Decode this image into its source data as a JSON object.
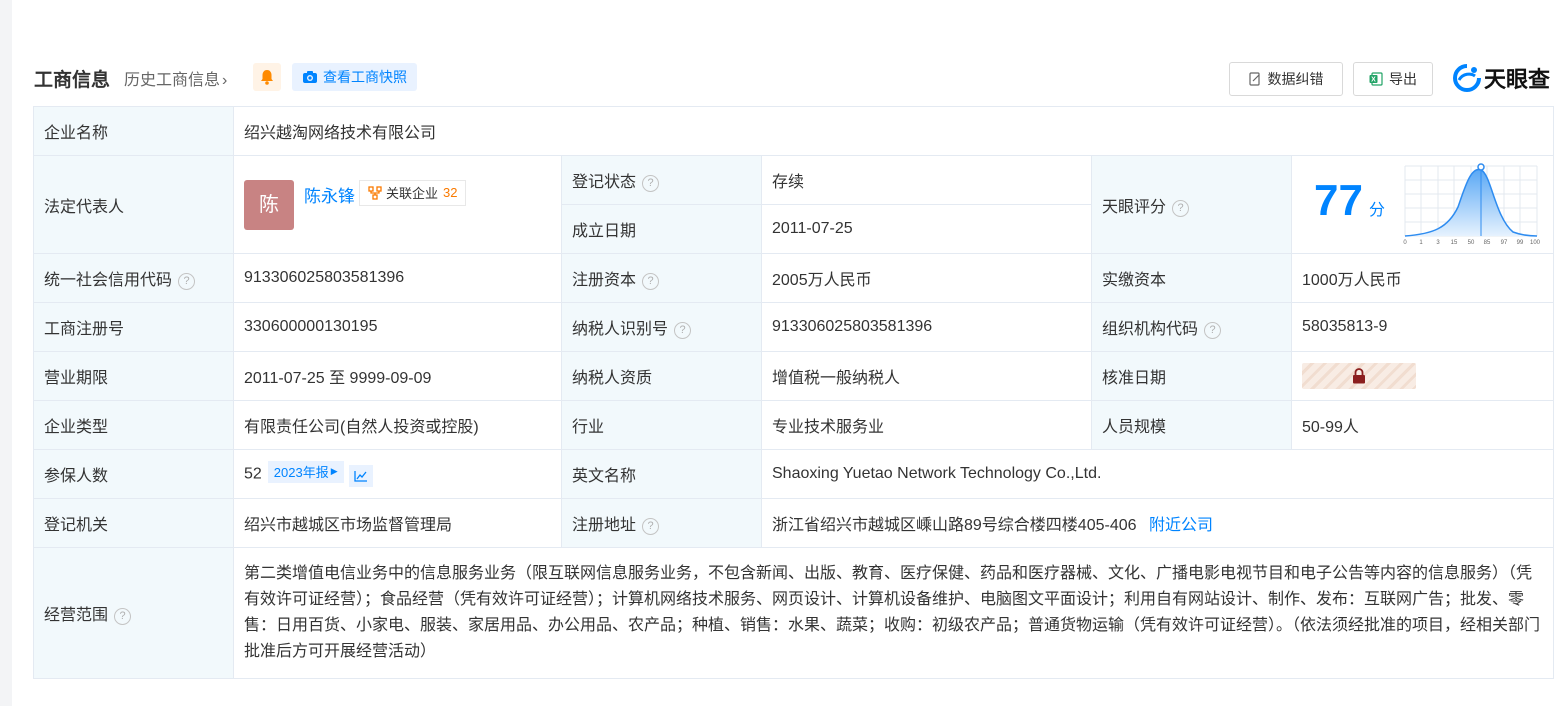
{
  "header": {
    "title": "工商信息",
    "history_link": "历史工商信息",
    "snapshot_label": "查看工商快照",
    "correct_label": "数据纠错",
    "export_label": "导出",
    "brand": "天眼查"
  },
  "labels": {
    "company_name": "企业名称",
    "legal_rep": "法定代表人",
    "reg_status": "登记状态",
    "founded": "成立日期",
    "tianyan_score": "天眼评分",
    "credit_code": "统一社会信用代码",
    "reg_capital": "注册资本",
    "paid_capital": "实缴资本",
    "reg_number": "工商注册号",
    "taxpayer_id": "纳税人识别号",
    "org_code": "组织机构代码",
    "term": "营业期限",
    "taxpayer_quality": "纳税人资质",
    "approval_date": "核准日期",
    "company_type": "企业类型",
    "industry": "行业",
    "staff_size": "人员规模",
    "insured": "参保人数",
    "english_name": "英文名称",
    "reg_authority": "登记机关",
    "reg_address": "注册地址",
    "business_scope": "经营范围"
  },
  "values": {
    "company_name": "绍兴越淘网络技术有限公司",
    "legal_rep_avatar": "陈",
    "legal_rep_name": "陈永锋",
    "assoc_label": "关联企业",
    "assoc_count": "32",
    "reg_status": "存续",
    "founded": "2011-07-25",
    "score": "77",
    "score_unit": "分",
    "credit_code": "913306025803581396",
    "reg_capital": "2005万人民币",
    "paid_capital": "1000万人民币",
    "reg_number": "330600000130195",
    "taxpayer_id": "913306025803581396",
    "org_code": "58035813-9",
    "term": "2011-07-25 至 9999-09-09",
    "taxpayer_quality": "增值税一般纳税人",
    "company_type": "有限责任公司(自然人投资或控股)",
    "industry": "专业技术服务业",
    "staff_size": "50-99人",
    "insured": "52",
    "insured_report": "2023年报",
    "english_name": "Shaoxing Yuetao Network Technology Co.,Ltd.",
    "reg_authority": "绍兴市越城区市场监督管理局",
    "reg_address": "浙江省绍兴市越城区嵊山路89号综合楼四楼405-406",
    "nearby_link": "附近公司",
    "business_scope": "第二类增值电信业务中的信息服务业务（限互联网信息服务业务，不包含新闻、出版、教育、医疗保健、药品和医疗器械、文化、广播电影电视节目和电子公告等内容的信息服务）（凭有效许可证经营）；食品经营（凭有效许可证经营）；计算机网络技术服务、网页设计、计算机设备维护、电脑图文平面设计；利用自有网站设计、制作、发布：互联网广告；批发、零售：日用百货、小家电、服装、家居用品、办公用品、农产品；种植、销售：水果、蔬菜；收购：初级农产品；普通货物运输（凭有效许可证经营）。（依法须经批准的项目，经相关部门批准后方可开展经营活动）"
  },
  "score_chart": {
    "ticks": [
      "0",
      "1",
      "3",
      "15",
      "50",
      "85",
      "97",
      "99",
      "100"
    ],
    "score_marker_tick": "50",
    "colors": {
      "curve": "#2e8cf0",
      "fill_top": "#5aa8f5",
      "fill_bottom": "#e6f2fe",
      "grid": "#e3e8ef"
    }
  },
  "colors": {
    "accent": "#0084ff",
    "status_green": "#28a745",
    "label_bg": "#f2f9fc",
    "avatar_bg": "#c88383"
  }
}
